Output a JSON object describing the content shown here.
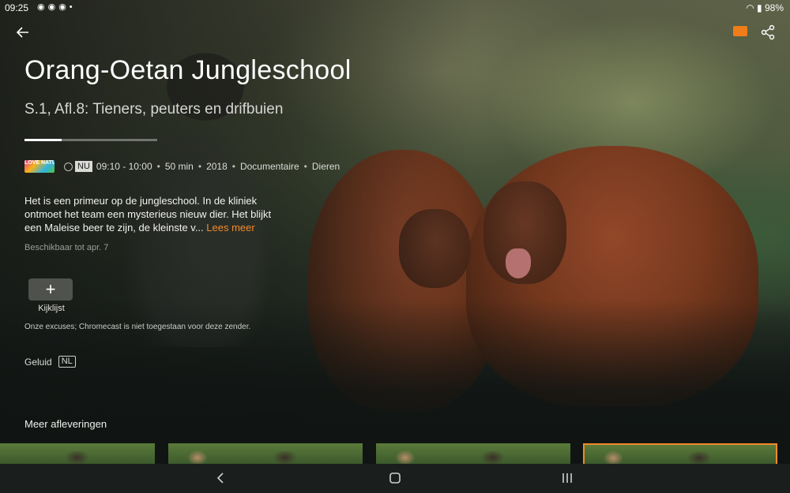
{
  "status_bar": {
    "time": "09:25",
    "battery": "98%"
  },
  "show": {
    "title": "Orang-Oetan Jungleschool",
    "episode": "S.1, Afl.8: Tieners, peuters en drifbuien",
    "progress_fraction": 0.28,
    "channel_logo_text": "LOVE NATURE",
    "live_badge": "NU",
    "time_range": "09:10 - 10:00",
    "duration": "50 min",
    "year": "2018",
    "genre": "Documentaire",
    "subgenre": "Dieren",
    "description": "Het is een primeur op de jungleschool. In de kliniek ontmoet het team een mysterieus nieuw dier. Het blijkt een Maleise beer te zijn, de kleinste v...",
    "read_more": "Lees meer",
    "availability": "Beschikbaar tot apr. 7"
  },
  "actions": {
    "watchlist_label": "Kijklijst",
    "watchlist_icon": "+"
  },
  "cast_note": "Onze excuses; Chromecast is niet toegestaan voor deze zender.",
  "audio": {
    "label": "Geluid",
    "language": "NL"
  },
  "more_episodes": {
    "title": "Meer afleveringen",
    "selected_index": 3
  },
  "icons": {
    "back": "arrow-left",
    "cast": "cast-icon",
    "share": "share-icon"
  },
  "colors": {
    "accent": "#f08a2a",
    "background": "#101513"
  }
}
